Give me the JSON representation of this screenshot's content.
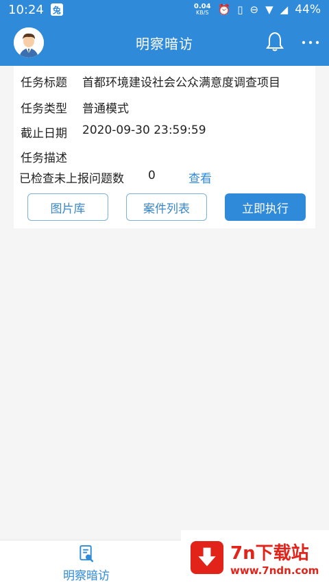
{
  "statusbar": {
    "time": "10:24",
    "net_speed": "0.04",
    "net_unit": "KB/S",
    "battery": "44%"
  },
  "appbar": {
    "title": "明察暗访"
  },
  "task": {
    "title_label": "任务标题",
    "title_value": "首都环境建设社会公众满意度调查项目",
    "type_label": "任务类型",
    "type_value": "普通模式",
    "deadline_label": "截止日期",
    "deadline_value": "2020-09-30 23:59:59",
    "desc_label": "任务描述",
    "issue_label": "已检查未上报问题数",
    "issue_count": "0",
    "view_link": "查看"
  },
  "buttons": {
    "gallery": "图片库",
    "case_list": "案件列表",
    "execute": "立即执行"
  },
  "bottomnav": {
    "home_label": "明察暗访"
  },
  "watermark": {
    "main": "7n下载站",
    "url": "www.7ndn.com"
  },
  "colors": {
    "primary": "#2f8ad9",
    "watermark_red": "#e2231a"
  }
}
